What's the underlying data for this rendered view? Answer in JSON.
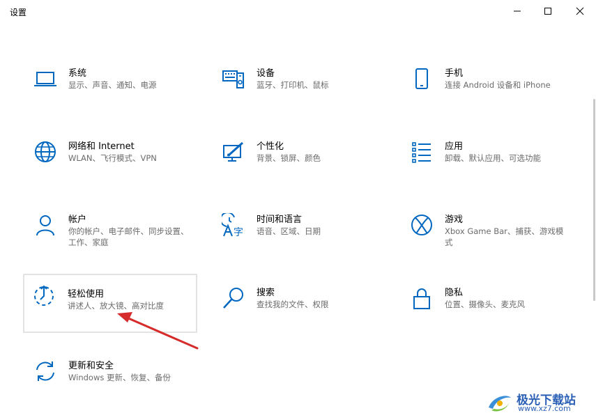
{
  "window": {
    "title": "设置",
    "minimize_icon": "minimize-icon",
    "maximize_icon": "maximize-icon",
    "close_icon": "close-icon"
  },
  "accent_color": "#0067c0",
  "tiles": [
    {
      "icon": "laptop-icon",
      "name": "系统",
      "desc": "显示、声音、通知、电源"
    },
    {
      "icon": "keyboard-device-icon",
      "name": "设备",
      "desc": "蓝牙、打印机、鼠标"
    },
    {
      "icon": "phone-icon",
      "name": "手机",
      "desc": "连接 Android 设备和 iPhone"
    },
    {
      "icon": "globe-icon",
      "name": "网络和 Internet",
      "desc": "WLAN、飞行模式、VPN"
    },
    {
      "icon": "personalization-icon",
      "name": "个性化",
      "desc": "背景、锁屏、颜色"
    },
    {
      "icon": "apps-list-icon",
      "name": "应用",
      "desc": "卸载、默认应用、可选功能"
    },
    {
      "icon": "person-icon",
      "name": "帐户",
      "desc": "你的帐户、电子邮件、同步设置、工作、家庭"
    },
    {
      "icon": "time-language-icon",
      "name": "时间和语言",
      "desc": "语音、区域、日期"
    },
    {
      "icon": "xbox-icon",
      "name": "游戏",
      "desc": "Xbox Game Bar、捕获、游戏模式"
    },
    {
      "icon": "ease-of-access-icon",
      "name": "轻松使用",
      "desc": "讲述人、放大镜、高对比度"
    },
    {
      "icon": "search-icon",
      "name": "搜索",
      "desc": "查找我的文件、权限"
    },
    {
      "icon": "lock-icon",
      "name": "隐私",
      "desc": "位置、摄像头、麦克风"
    },
    {
      "icon": "update-sync-icon",
      "name": "更新和安全",
      "desc": "Windows 更新、恢复、备份"
    }
  ],
  "watermark": {
    "name": "极光下载站",
    "url": "www.xz7.com"
  }
}
